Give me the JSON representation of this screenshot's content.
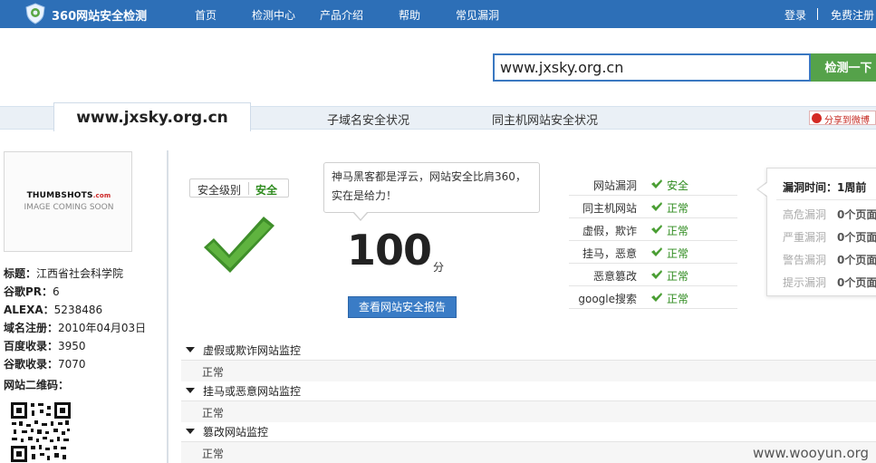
{
  "header": {
    "brand": "360网站安全检测",
    "nav": [
      "首页",
      "检测中心",
      "产品介绍",
      "帮助",
      "常见漏洞"
    ],
    "login": "登录",
    "register": "免费注册"
  },
  "search": {
    "value": "www.jxsky.org.cn",
    "button": "检测一下"
  },
  "tabs": {
    "active": "www.jxsky.org.cn",
    "subdomain": "子域名安全状况",
    "same_host": "同主机网站安全状况",
    "share": "分享到微博"
  },
  "site_info": {
    "thumb_line1": "THUMBSHOTS",
    "thumb_com": ".com",
    "thumb_line2": "IMAGE COMING SOON",
    "title_label": "标题：",
    "title_value": "江西省社会科学院",
    "pr_label": "谷歌PR：",
    "pr_value": "6",
    "alexa_label": "ALEXA：",
    "alexa_value": "5238486",
    "domain_label": "域名注册：",
    "domain_value": "2010年04月03日",
    "baidu_label": "百度收录：",
    "baidu_value": "3950",
    "google_label": "谷歌收录：",
    "google_value": "7070",
    "qr_label": "网站二维码："
  },
  "security": {
    "level_label": "安全级别",
    "level_value": "安全",
    "bubble": "神马黑客都是浮云，网站安全比肩360，实在是给力！",
    "score": "100",
    "score_unit": "分",
    "report_button": "查看网站安全报告"
  },
  "status": [
    {
      "name": "网站漏洞",
      "value": "安全"
    },
    {
      "name": "同主机网站",
      "value": "正常"
    },
    {
      "name": "虚假，欺诈",
      "value": "正常"
    },
    {
      "name": "挂马，恶意",
      "value": "正常"
    },
    {
      "name": "恶意篡改",
      "value": "正常"
    },
    {
      "name": "google搜索",
      "value": "正常"
    }
  ],
  "vuln": {
    "title_label": "漏洞时间：",
    "title_value": "1周前",
    "rows": [
      {
        "label": "高危漏洞",
        "count": "0个页面"
      },
      {
        "label": "严重漏洞",
        "count": "0个页面"
      },
      {
        "label": "警告漏洞",
        "count": "0个页面"
      },
      {
        "label": "提示漏洞",
        "count": "0个页面"
      }
    ]
  },
  "monitors": [
    {
      "title": "虚假或欺诈网站监控",
      "status": "正常"
    },
    {
      "title": "挂马或恶意网站监控",
      "status": "正常"
    },
    {
      "title": "篡改网站监控",
      "status": "正常"
    }
  ],
  "watermark": "www.wooyun.org",
  "colors": {
    "topbar": "#2d6fb7",
    "safe_green": "#2e8b1e",
    "search_button": "#55a24a",
    "report_button": "#3a7cc6"
  }
}
